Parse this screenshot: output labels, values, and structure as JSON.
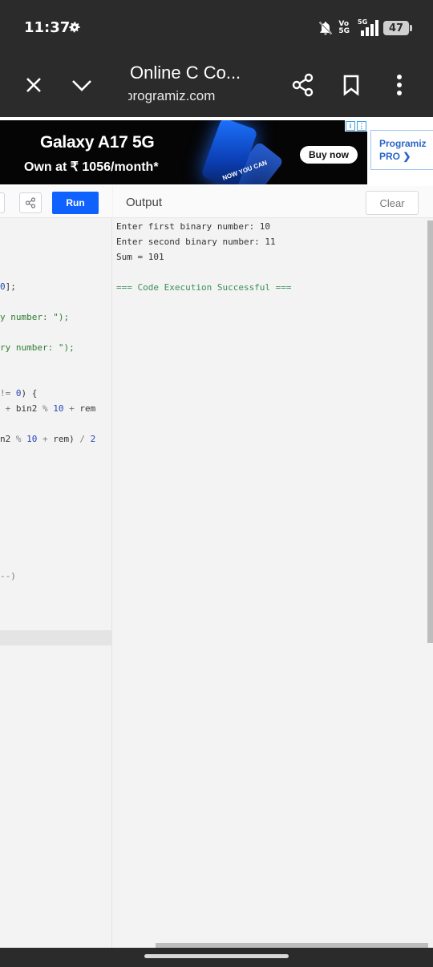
{
  "status_bar": {
    "time": "11:37",
    "network_top": "Vo",
    "network_bottom": "5G",
    "signal_label": "5G",
    "battery": "47"
  },
  "browser": {
    "page_title": "Online C Co...",
    "url": "programiz.com"
  },
  "ad": {
    "title": "Galaxy A17 5G",
    "subtitle": "Own at ₹ 1056/month*",
    "badge": "NOW YOU CAN",
    "button": "Buy now",
    "pro_line1": "Programiz",
    "pro_line2": "PRO ❯"
  },
  "editor": {
    "run_label": "Run",
    "code_lines": [
      {
        "parts": [
          {
            "t": "0",
            "c": "num"
          },
          {
            "t": "];",
            "c": "plain"
          }
        ]
      },
      {
        "parts": [
          {
            "t": "y number: \");",
            "c": "str"
          }
        ]
      },
      {
        "parts": [
          {
            "t": "ry number: \");",
            "c": "str"
          }
        ]
      },
      {
        "parts": [
          {
            "t": "!= ",
            "c": "op"
          },
          {
            "t": "0",
            "c": "num"
          },
          {
            "t": ") {",
            "c": "plain"
          }
        ]
      },
      {
        "parts": [
          {
            "t": " + ",
            "c": "op"
          },
          {
            "t": "bin2 ",
            "c": "plain"
          },
          {
            "t": "% ",
            "c": "op"
          },
          {
            "t": "10 ",
            "c": "num"
          },
          {
            "t": "+ ",
            "c": "op"
          },
          {
            "t": "rem",
            "c": "plain"
          }
        ]
      },
      {
        "parts": [
          {
            "t": "n2 ",
            "c": "plain"
          },
          {
            "t": "% ",
            "c": "op"
          },
          {
            "t": "10 ",
            "c": "num"
          },
          {
            "t": "+ ",
            "c": "op"
          },
          {
            "t": "rem) ",
            "c": "plain"
          },
          {
            "t": "/ ",
            "c": "op"
          },
          {
            "t": "2",
            "c": "num"
          }
        ]
      },
      {
        "parts": [
          {
            "t": "--)",
            "c": "op"
          }
        ]
      }
    ]
  },
  "output": {
    "title": "Output",
    "clear_label": "Clear",
    "lines": [
      "Enter first binary number: 10",
      "Enter second binary number: 11",
      "Sum = 101"
    ],
    "success": "=== Code Execution Successful ==="
  }
}
